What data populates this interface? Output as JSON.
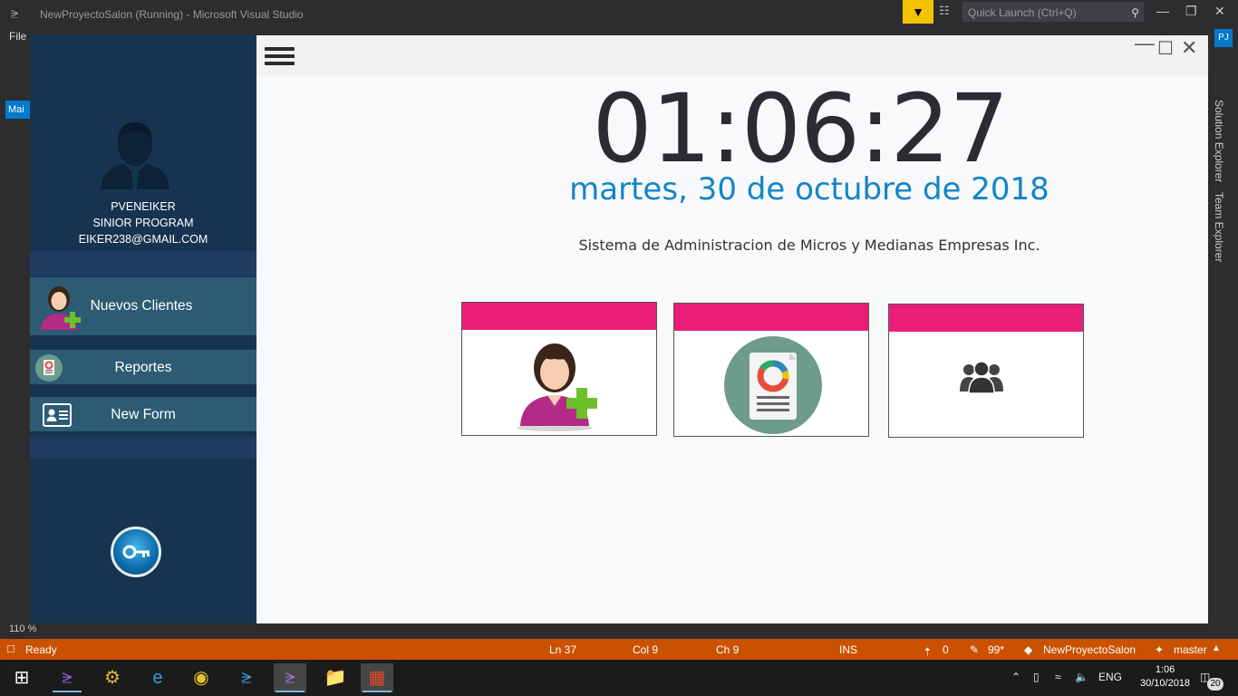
{
  "vs": {
    "title": "NewProyectoSalon (Running) - Microsoft Visual Studio",
    "quick_launch": "Quick Launch (Ctrl+Q)",
    "menu_first": "File",
    "user_initials": "PJ",
    "left_tab": "Mai",
    "side_tabs": [
      "Solution Explorer",
      "Team Explorer"
    ],
    "zoom": "110 %"
  },
  "status_bar": {
    "ready": "Ready",
    "ln": "Ln 37",
    "col": "Col 9",
    "ch": "Ch 9",
    "ins": "INS",
    "up_count": "0",
    "pencil_count": "99*",
    "project": "NewProyectoSalon",
    "branch": "master"
  },
  "taskbar": {
    "language": "ENG",
    "time": "1:06",
    "date": "30/10/2018",
    "notifications": "20"
  },
  "app": {
    "user": {
      "name": "PVENEIKER",
      "role": "SINIOR PROGRAM",
      "email": "EIKER238@GMAIL.COM"
    },
    "nav": {
      "nuevos_clientes": "Nuevos Clientes",
      "reportes": "Reportes",
      "new_form": "New Form"
    },
    "clock": "01:06:27",
    "date": "martes, 30 de octubre de 2018",
    "tagline": "Sistema de Administracion de Micros y Medianas Empresas Inc.",
    "accent_color": "#ea1e78",
    "sidebar_color": "#16344f"
  }
}
